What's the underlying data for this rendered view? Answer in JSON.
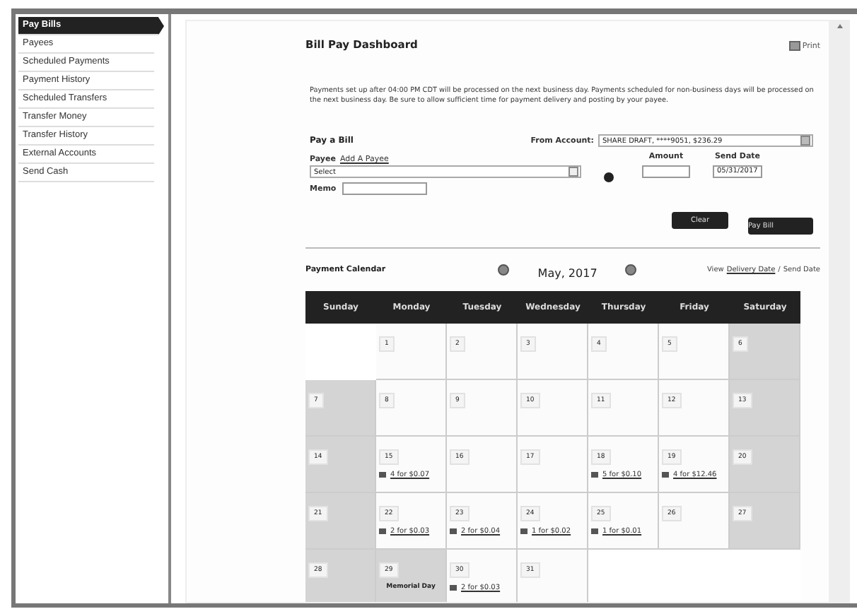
{
  "sidebar": {
    "items": [
      {
        "label": "Pay Bills",
        "selected": true
      },
      {
        "label": "Payees",
        "selected": false
      },
      {
        "label": "Scheduled Payments",
        "selected": false
      },
      {
        "label": "Payment History",
        "selected": false
      },
      {
        "label": "Scheduled Transfers",
        "selected": false
      },
      {
        "label": "Transfer Money",
        "selected": false
      },
      {
        "label": "Transfer History",
        "selected": false
      },
      {
        "label": "External Accounts",
        "selected": false
      },
      {
        "label": "Send Cash",
        "selected": false
      }
    ]
  },
  "header": {
    "title": "Bill Pay Dashboard",
    "print": "Print"
  },
  "notice": "Payments set up after 04:00 PM CDT will be processed on the next business day. Payments scheduled for non-business days will be processed on the next business day. Be sure to allow sufficient time for payment delivery and posting by your payee.",
  "form": {
    "title": "Pay a Bill",
    "from_label": "From Account:",
    "from_value": "SHARE DRAFT, ****9051, $236.29",
    "payee_label": "Payee",
    "add_payee": "Add A Payee",
    "payee_value": "Select",
    "amount_label": "Amount",
    "send_date_label": "Send Date",
    "send_date": "05/31/2017",
    "memo_label": "Memo",
    "buttons": [
      "Clear",
      "Pay Bill"
    ]
  },
  "calendar": {
    "title": "Payment Calendar",
    "month": "May, 2017",
    "view_label": "View",
    "view_delivery": "Delivery Date",
    "view_sep": "/",
    "view_send": "Send Date",
    "weekdays": [
      "Sunday",
      "Monday",
      "Tuesday",
      "Wednesday",
      "Thursday",
      "Friday",
      "Saturday"
    ],
    "weeks": [
      [
        {
          "day": "1",
          "shaded": false
        },
        {
          "day": "2",
          "shaded": false
        },
        {
          "day": "3",
          "shaded": false
        },
        {
          "day": "4",
          "shaded": false
        },
        {
          "day": "5",
          "shaded": false
        },
        {
          "day": "6",
          "shaded": true
        }
      ],
      [
        {
          "day": "7",
          "shaded": true
        },
        {
          "day": "8",
          "shaded": false
        },
        {
          "day": "9",
          "shaded": false
        },
        {
          "day": "10",
          "shaded": false
        },
        {
          "day": "11",
          "shaded": false
        },
        {
          "day": "12",
          "shaded": false
        },
        {
          "day": "13",
          "shaded": true
        }
      ],
      [
        {
          "day": "14",
          "shaded": true
        },
        {
          "day": "15",
          "shaded": false,
          "payments": "4 for $0.07"
        },
        {
          "day": "16",
          "shaded": false
        },
        {
          "day": "17",
          "shaded": false
        },
        {
          "day": "18",
          "shaded": false,
          "payments": "5 for $0.10"
        },
        {
          "day": "19",
          "shaded": false,
          "payments": "4 for $12.46"
        },
        {
          "day": "20",
          "shaded": true
        }
      ],
      [
        {
          "day": "21",
          "shaded": true
        },
        {
          "day": "22",
          "shaded": false,
          "payments": "2 for $0.03"
        },
        {
          "day": "23",
          "shaded": false,
          "payments": "2 for $0.04"
        },
        {
          "day": "24",
          "shaded": false,
          "payments": "1 for $0.02"
        },
        {
          "day": "25",
          "shaded": false,
          "payments": "1 for $0.01"
        },
        {
          "day": "26",
          "shaded": false
        },
        {
          "day": "27",
          "shaded": true
        }
      ],
      [
        {
          "day": "28",
          "shaded": true
        },
        {
          "day": "29",
          "shaded": true,
          "note": "Memorial Day"
        },
        {
          "day": "30",
          "shaded": false,
          "payments": "2 for $0.03"
        },
        {
          "day": "31",
          "shaded": false
        }
      ]
    ]
  }
}
